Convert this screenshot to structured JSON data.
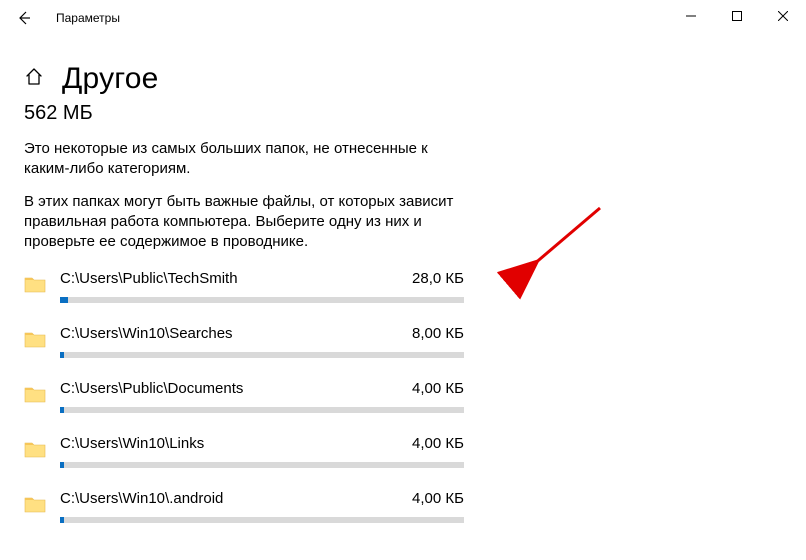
{
  "window": {
    "title": "Параметры"
  },
  "page": {
    "title": "Другое",
    "total": "562 МБ",
    "desc1": "Это некоторые из самых больших папок, не отнесенные к каким-либо категориям.",
    "desc2": "В этих папках могут быть важные файлы, от которых зависит правильная работа компьютера. Выберите одну из них и проверьте ее содержимое в проводнике."
  },
  "folders": [
    {
      "path": "C:\\Users\\Public\\TechSmith",
      "size": "28,0 КБ",
      "pct": 2
    },
    {
      "path": "C:\\Users\\Win10\\Searches",
      "size": "8,00 КБ",
      "pct": 1
    },
    {
      "path": "C:\\Users\\Public\\Documents",
      "size": "4,00 КБ",
      "pct": 1
    },
    {
      "path": "C:\\Users\\Win10\\Links",
      "size": "4,00 КБ",
      "pct": 1
    },
    {
      "path": "C:\\Users\\Win10\\.android",
      "size": "4,00 КБ",
      "pct": 1
    }
  ],
  "colors": {
    "accent": "#0a6fc2",
    "track": "#d9d9d9",
    "arrow": "#e10000"
  }
}
